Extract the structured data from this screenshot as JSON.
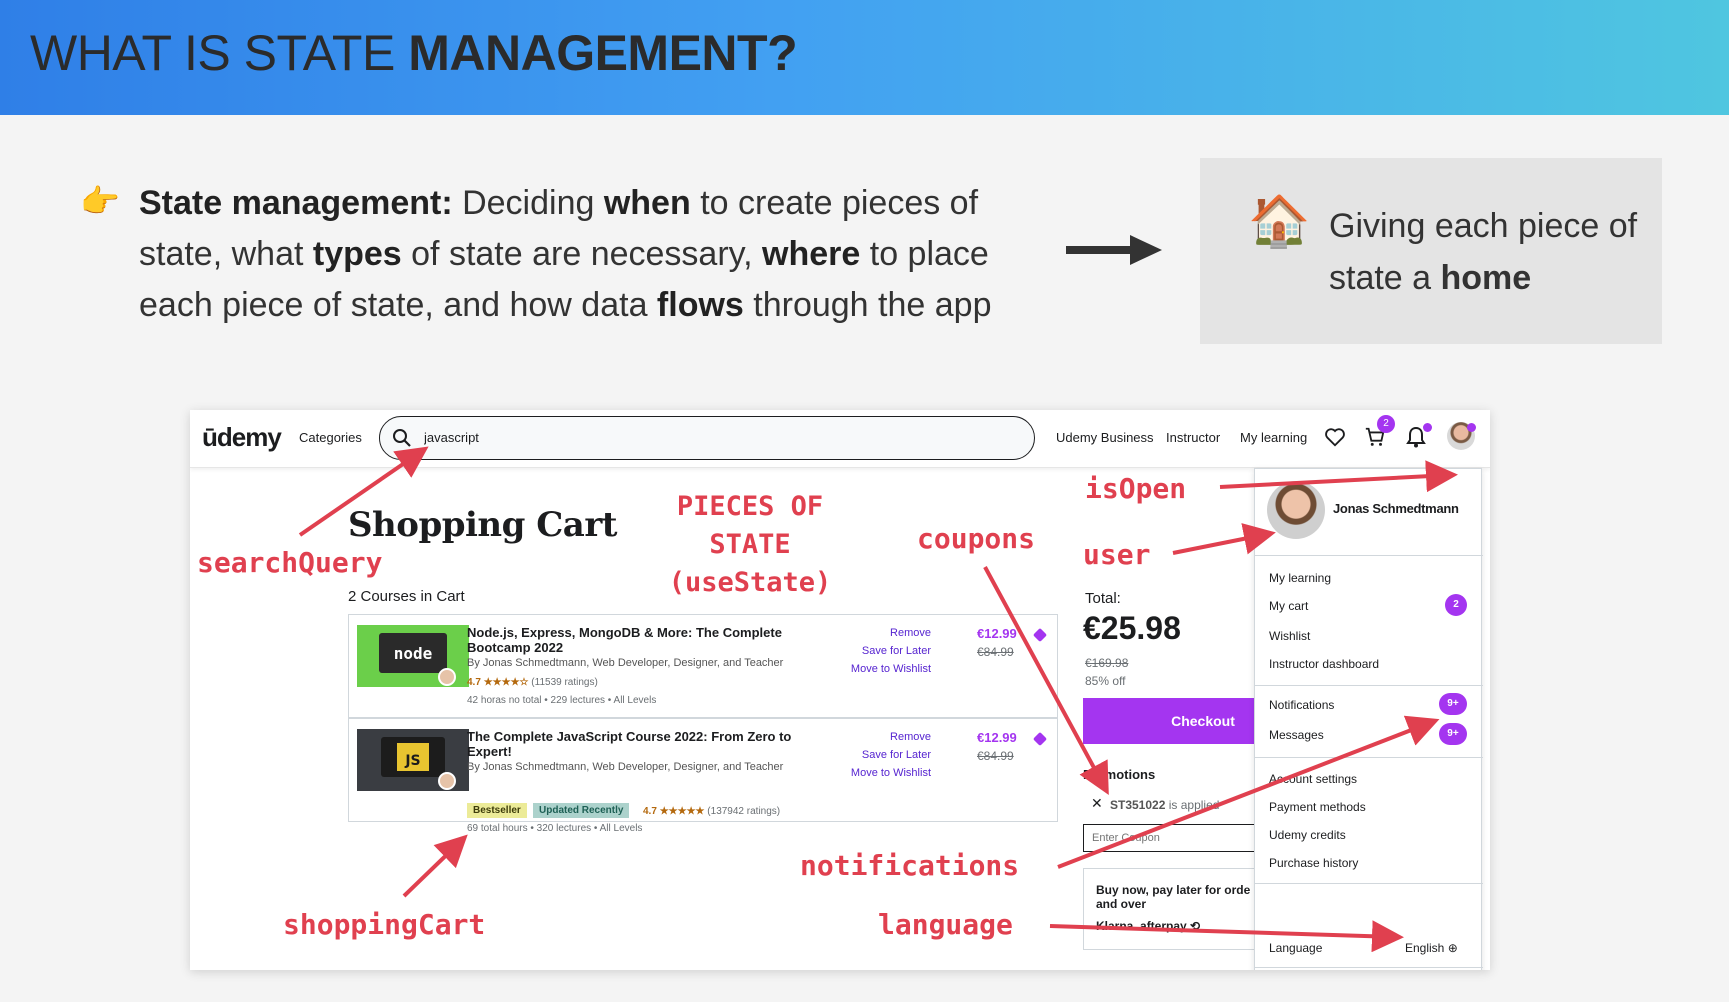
{
  "slide": {
    "title_plain": "WHAT IS STATE ",
    "title_bold": "MANAGEMENT?",
    "bullet_icon": "pointing-hand-icon",
    "def_bold_1": "State management:",
    "def_t1": " Deciding ",
    "def_b2": "when",
    "def_t2": " to create pieces of state, what ",
    "def_b3": "types",
    "def_t3": " of state are necessary, ",
    "def_b4": "where",
    "def_t4": " to place each piece of state, and how data ",
    "def_b5": "flows",
    "def_t5": " through the app",
    "home_icon": "house-icon",
    "home_t1": "Giving each piece of state a ",
    "home_b": "home"
  },
  "udemy": {
    "logo": "ūdemy",
    "nav": {
      "categories": "Categories",
      "search_value": "javascript",
      "business": "Udemy Business",
      "instructor": "Instructor",
      "my_learning": "My learning",
      "cart_count": "2"
    },
    "cart": {
      "title": "Shopping Cart",
      "count": "2 Courses in Cart",
      "courses": [
        {
          "title": "Node.js, Express, MongoDB & More: The Complete Bootcamp 2022",
          "by": "By Jonas Schmedtmann, Web Developer, Designer, and Teacher",
          "rating": "4.7",
          "stars": "★★★★☆",
          "ratings": "(11539 ratings)",
          "meta": "42 horas no total • 229 lectures • All Levels",
          "remove": "Remove",
          "save": "Save for Later",
          "wishlist": "Move to Wishlist",
          "price": "€12.99",
          "old_price": "€84.99"
        },
        {
          "title": "The Complete JavaScript Course 2022: From Zero to Expert!",
          "by": "By Jonas Schmedtmann, Web Developer, Designer, and Teacher",
          "badge_1": "Bestseller",
          "badge_2": "Updated Recently",
          "rating": "4.7",
          "stars": "★★★★★",
          "ratings": "(137942 ratings)",
          "meta": "69 total hours • 320 lectures • All Levels",
          "remove": "Remove",
          "save": "Save for Later",
          "wishlist": "Move to Wishlist",
          "price": "€12.99",
          "old_price": "€84.99"
        }
      ],
      "total_label": "Total:",
      "total": "€25.98",
      "total_old": "€169.98",
      "total_off": "85% off",
      "checkout": "Checkout",
      "promotions": "Promotions",
      "promo_code": "ST351022",
      "promo_suffix": " is applied",
      "coupon_placeholder": "Enter Coupon",
      "pay_later": "Buy now, pay later for orde and over",
      "pay_brands": "Klarna. afterpay ⟲"
    },
    "menu": {
      "name": "Jonas Schmedtmann",
      "items_1": [
        "My learning",
        "My cart",
        "Wishlist",
        "Instructor dashboard"
      ],
      "my_cart_badge": "2",
      "items_2": [
        "Notifications",
        "Messages"
      ],
      "notif_badge": "9+",
      "msg_badge": "9+",
      "items_3": [
        "Account settings",
        "Payment methods",
        "Udemy credits",
        "Purchase history"
      ],
      "language": "Language",
      "language_value": "English"
    }
  },
  "annotations": {
    "pieces_l1": "PIECES OF",
    "pieces_l2": "STATE",
    "pieces_l3": "(useState)",
    "searchQuery": "searchQuery",
    "isOpen": "isOpen",
    "user": "user",
    "coupons": "coupons",
    "notifications": "notifications",
    "shoppingCart": "shoppingCart",
    "language": "language",
    "color": "#e0404f"
  }
}
